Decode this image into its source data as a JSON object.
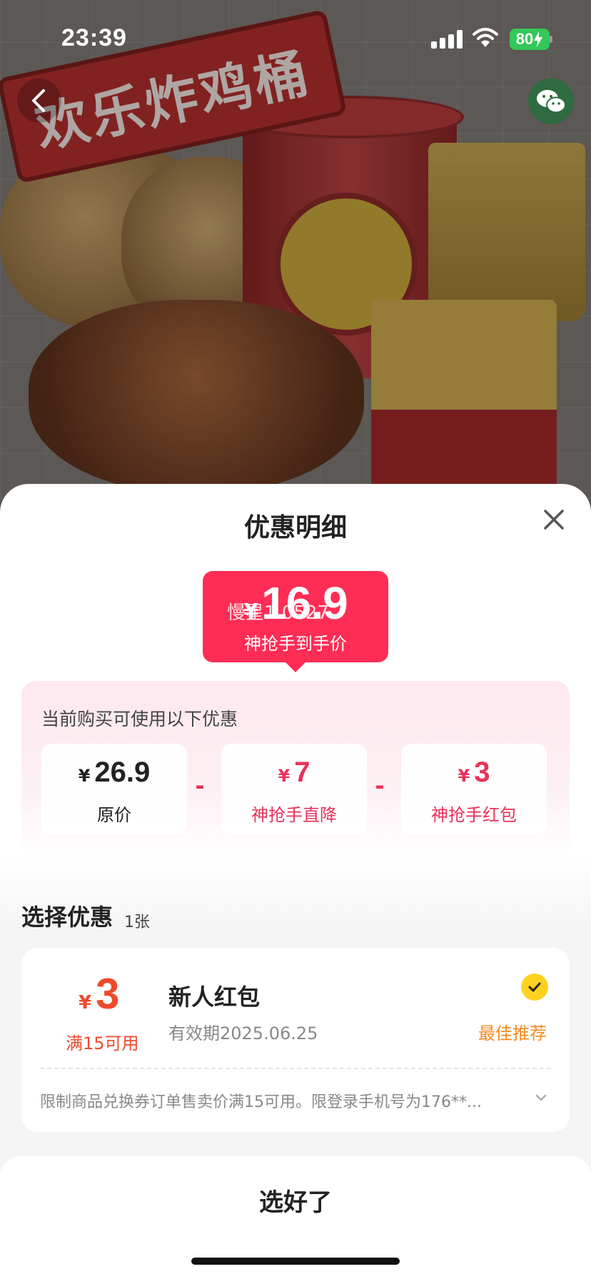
{
  "status_bar": {
    "time": "23:39",
    "battery": "80"
  },
  "hero": {
    "banner_text": "欢乐炸鸡桶"
  },
  "sheet": {
    "title": "优惠明细",
    "final_price": {
      "currency": "¥",
      "amount": "16.9",
      "watermark": "慢星1.0527",
      "label": "神抢手到手价"
    },
    "discount": {
      "hint": "当前购买可使用以下优惠",
      "operator": "-",
      "items": [
        {
          "currency": "¥",
          "amount": "26.9",
          "label": "原价"
        },
        {
          "currency": "¥",
          "amount": "7",
          "label": "神抢手直降"
        },
        {
          "currency": "¥",
          "amount": "3",
          "label": "神抢手红包"
        }
      ]
    },
    "select": {
      "title": "选择优惠",
      "count": "1张"
    },
    "coupon": {
      "currency": "¥",
      "amount": "3",
      "condition": "满15可用",
      "name": "新人红包",
      "validity": "有效期2025.06.25",
      "tag": "最佳推荐",
      "rule": "限制商品兑换券订单售卖价满15可用。限登录手机号为176**..."
    },
    "confirm_label": "选好了"
  },
  "colors": {
    "accent_pink": "#ff2d55",
    "discount_pink": "#e8325a",
    "coupon_red": "#f04a2c",
    "best_orange": "#f58a1f",
    "check_yellow": "#ffd21f"
  }
}
